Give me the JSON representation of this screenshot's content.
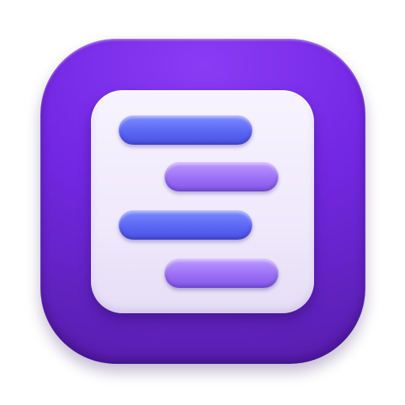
{
  "icon": {
    "name": "document-lines-app-icon",
    "colors": {
      "outer_top": "#8a3cf4",
      "outer_bottom": "#5a1fb2",
      "card": "#f2edfc",
      "bar_blue": "#5c66f4",
      "bar_violet": "#9b6ff5"
    },
    "bars": [
      {
        "name": "text-line-bar-1",
        "color": "blue"
      },
      {
        "name": "text-line-bar-2",
        "color": "violet"
      },
      {
        "name": "text-line-bar-3",
        "color": "blue"
      },
      {
        "name": "text-line-bar-4",
        "color": "violet"
      }
    ]
  }
}
